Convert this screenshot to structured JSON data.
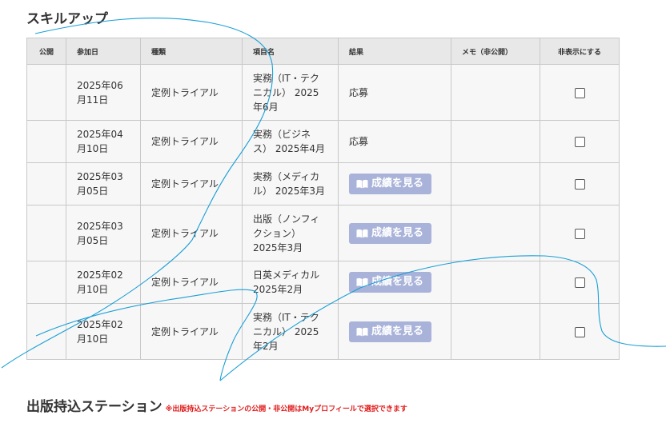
{
  "skillup": {
    "title": "スキルアップ",
    "columns": {
      "public": "公開",
      "date": "参加日",
      "kind": "種類",
      "item": "項目名",
      "result": "結果",
      "memo": "メモ（非公開）",
      "hide": "非表示にする"
    },
    "rows": [
      {
        "date": "2025年06月11日",
        "kind": "定例トライアル",
        "item": "実務（IT・テクニカル） 2025年6月",
        "result": "応募",
        "hidden": false
      },
      {
        "date": "2025年04月10日",
        "kind": "定例トライアル",
        "item": "実務（ビジネス） 2025年4月",
        "result": "応募",
        "hidden": false
      },
      {
        "date": "2025年03月05日",
        "kind": "定例トライアル",
        "item": "実務（メディカル） 2025年3月",
        "result_button": "成績を見る",
        "hidden": false
      },
      {
        "date": "2025年03月05日",
        "kind": "定例トライアル",
        "item": "出版（ノンフィクション） 2025年3月",
        "result_button": "成績を見る",
        "hidden": false
      },
      {
        "date": "2025年02月10日",
        "kind": "定例トライアル",
        "item": "日英メディカル 2025年2月",
        "result_button": "成績を見る",
        "hidden": false
      },
      {
        "date": "2025年02月10日",
        "kind": "定例トライアル",
        "item": "実務（IT・テクニカル） 2025年2月",
        "result_button": "成績を見る",
        "hidden": false
      }
    ]
  },
  "station": {
    "title": "出版持込ステーション",
    "note": "※出版持込ステーションの公開・非公開はMyプロフィールで選択できます"
  },
  "icons": {
    "result_button_icon": "open-book-icon"
  },
  "colors": {
    "header_bg": "#e8e8e8",
    "row_bg": "#f7f7f7",
    "button_bg": "#a9b3d9",
    "note_red": "#e01b1b",
    "annotation_stroke": "#1a9fd6"
  }
}
